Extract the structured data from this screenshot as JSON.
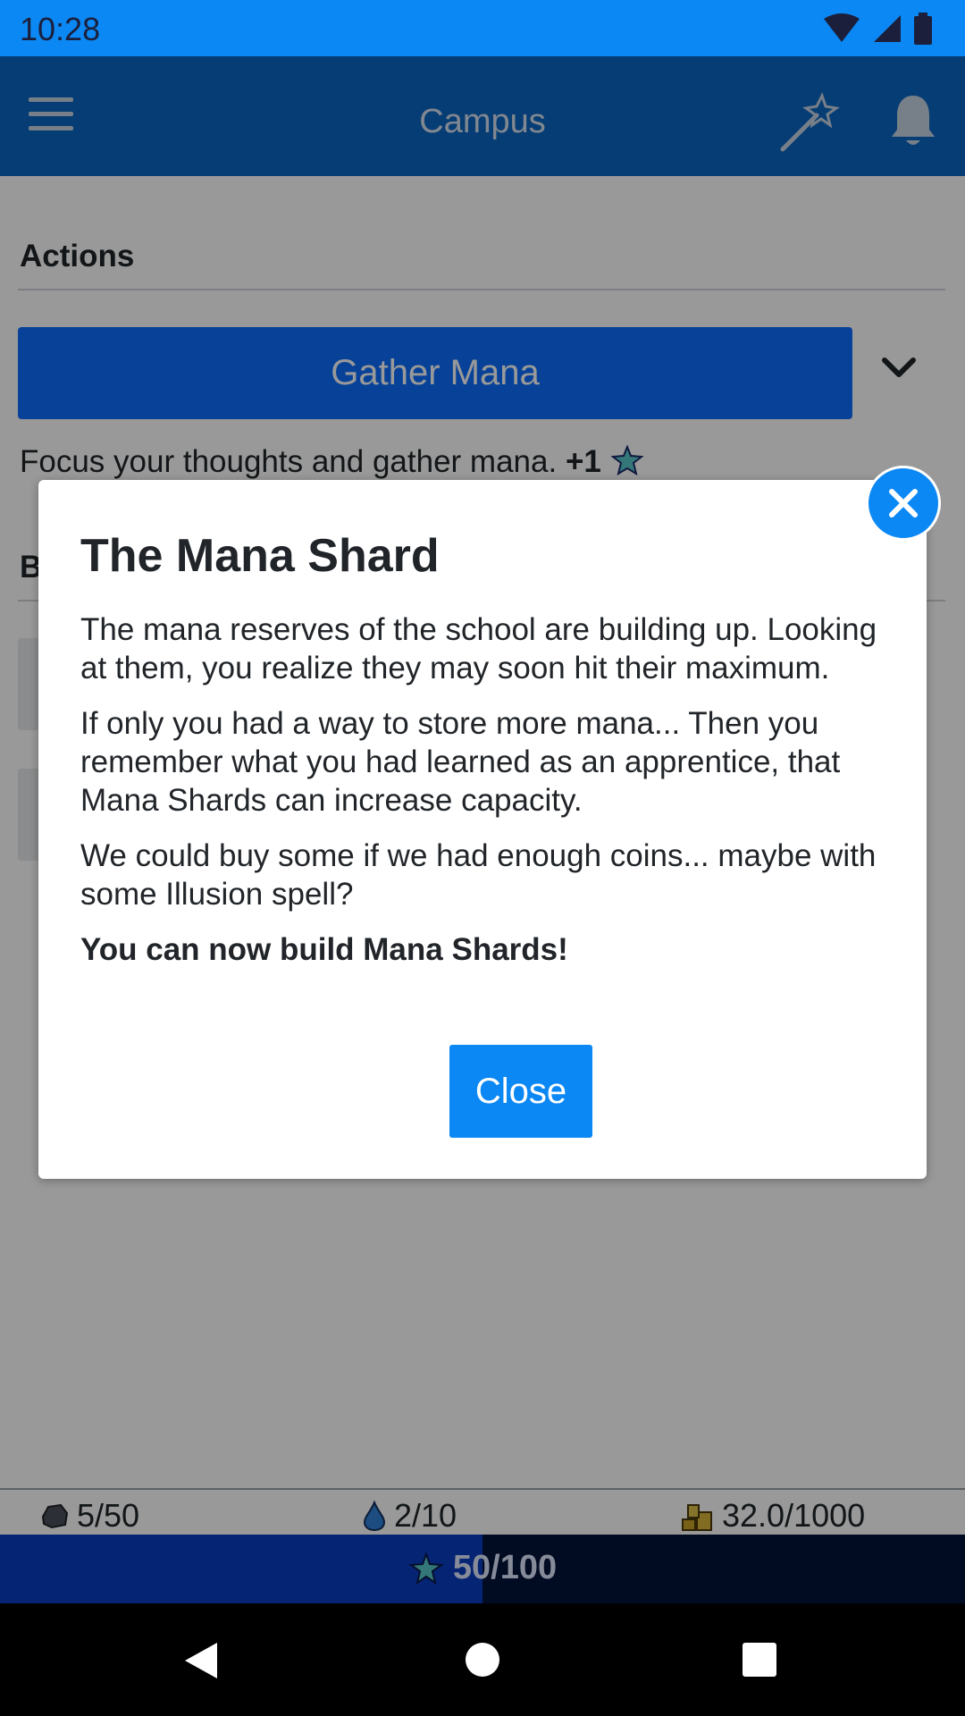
{
  "status": {
    "time": "10:28"
  },
  "appbar": {
    "title": "Campus",
    "menu_icon": "hamburger-menu-icon",
    "wand_icon": "magic-wand-icon",
    "bell_icon": "bell-icon"
  },
  "actions": {
    "heading": "Actions",
    "gather_label": "Gather Mana",
    "description": "Focus your thoughts and gather mana.",
    "reward": "+1"
  },
  "build_section": {
    "heading_initial": "B"
  },
  "resources": {
    "stone": "5/50",
    "water": "2/10",
    "gold": "32.0/1000",
    "mana": "50/100",
    "mana_fraction": 0.5
  },
  "modal": {
    "title": "The Mana Shard",
    "paragraphs": [
      "The mana reserves of the school are building up. Looking at them, you realize they may soon hit their maximum.",
      "If only you had a way to store more mana... Then you remember what you had learned as an apprentice, that Mana Shards can increase capacity.",
      "We could buy some if we had enough coins... maybe with some Illusion spell?"
    ],
    "emphasis": "You can now build Mana Shards!",
    "close_label": "Close"
  },
  "colors": {
    "status_bar": "#0b88f4",
    "app_bar": "#0a66c2",
    "primary_button": "#0d6efd",
    "modal_button": "#0b88f4",
    "mana_bar_fill": "#0a3cc2",
    "mana_bar_bg": "#03133a"
  }
}
